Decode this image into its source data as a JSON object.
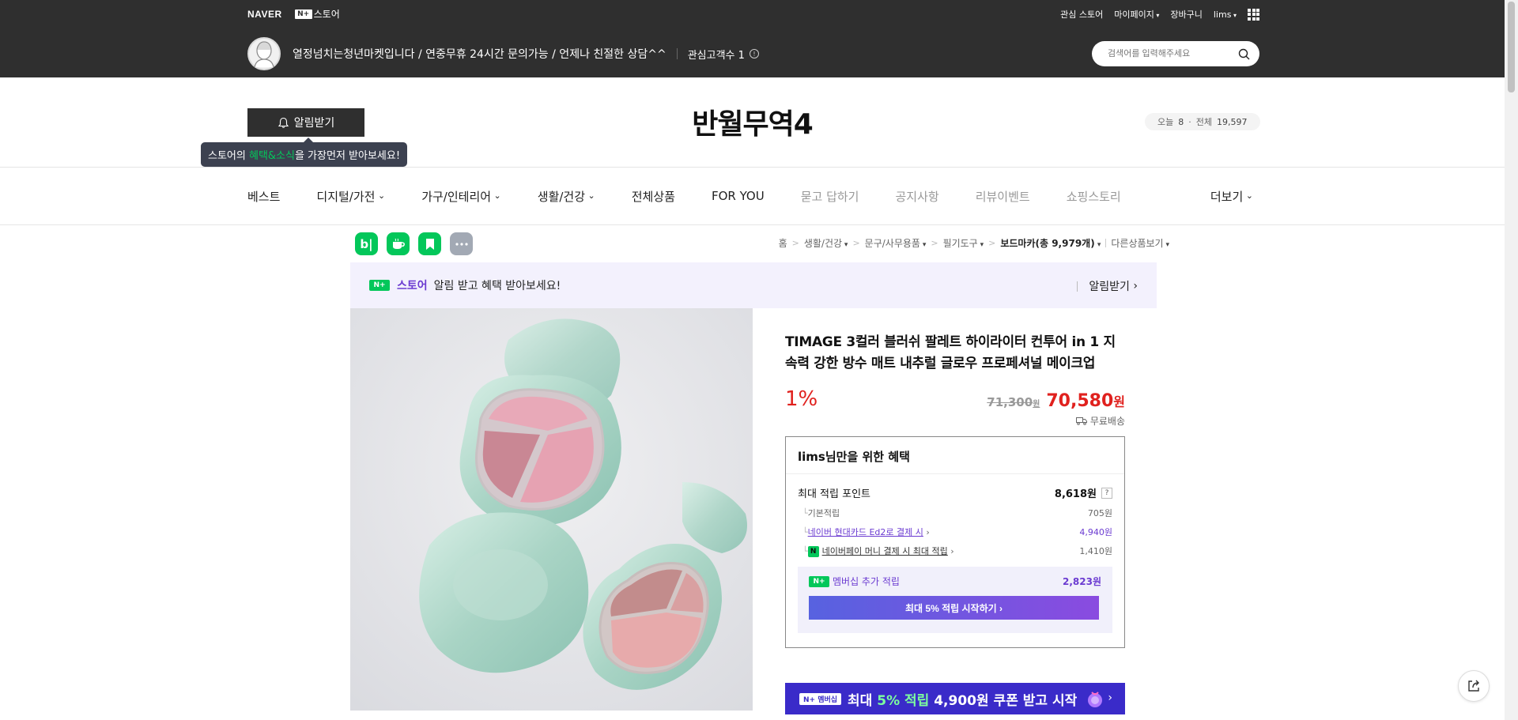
{
  "topbar": {
    "naver": "NAVER",
    "np_badge": "N+",
    "np_store": "스토어",
    "links": [
      "관심 스토어",
      "마이페이지",
      "장바구니",
      "lims"
    ]
  },
  "store": {
    "description": "열정넘치는청년마켓입니다 / 연중무휴 24시간 문의가능 / 언제나 친절한 상담^^",
    "fans_label": "관심고객수 1",
    "search_placeholder": "검색어를 입력해주세요",
    "name": "반월무역4",
    "alarm_button": "알림받기",
    "tooltip_pre": "스토어의 ",
    "tooltip_hl": "혜택&소식",
    "tooltip_post": "을 가장먼저 받아보세요!",
    "visit_today_label": "오늘",
    "visit_today": "8",
    "visit_total_label": "전체",
    "visit_total": "19,597"
  },
  "nav": {
    "items": [
      "베스트",
      "디지털/가전",
      "가구/인테리어",
      "생활/건강",
      "전체상품",
      "FOR YOU",
      "묻고 답하기",
      "공지사항",
      "리뷰이벤트",
      "쇼핑스토리"
    ],
    "more": "더보기"
  },
  "social": {
    "blog": "b|"
  },
  "breadcrumb": {
    "home": "홈",
    "cat1": "생활/건강",
    "cat2": "문구/사무용품",
    "cat3": "필기도구",
    "cat4": "보드마카(총 9,979개)",
    "other": "다른상품보기"
  },
  "notice": {
    "badge": "N+",
    "store": "스토어",
    "text": "알림 받고 혜택 받아보세요!",
    "action": "알림받기"
  },
  "product": {
    "title": "TIMAGE 3컬러 블러쉬 팔레트 하이라이터 컨투어 in 1 지속력 강한 방수 매트 내추럴 글로우 프로페셔널 메이크업",
    "discount": "1%",
    "original_price": "71,300",
    "original_unit": "원",
    "sale_price": "70,580",
    "sale_unit": "원",
    "shipping": "무료배송"
  },
  "benefit": {
    "title": "lims님만을 위한 혜택",
    "max_point_label": "최대 적립 포인트",
    "max_point": "8,618원",
    "help": "?",
    "basic_label": "기본적립",
    "basic_val": "705원",
    "card_label": "네이버 현대카드 Ed2로 결제 시",
    "card_val": "4,940원",
    "npay_icon": "N",
    "npay_label": "네이버페이 머니 결제 시 최대 적립",
    "npay_val": "1,410원",
    "member_badge": "N+",
    "member_label": "멤버십 추가 적립",
    "member_val": "2,823원",
    "member_button": "최대 5% 적립 시작하기 ›"
  },
  "coupon": {
    "badge": "N+ 멤버십",
    "text_pre": "최대 ",
    "text_hl": "5% 적립",
    "text_post": " 4,900원 쿠폰 받고 시작"
  }
}
